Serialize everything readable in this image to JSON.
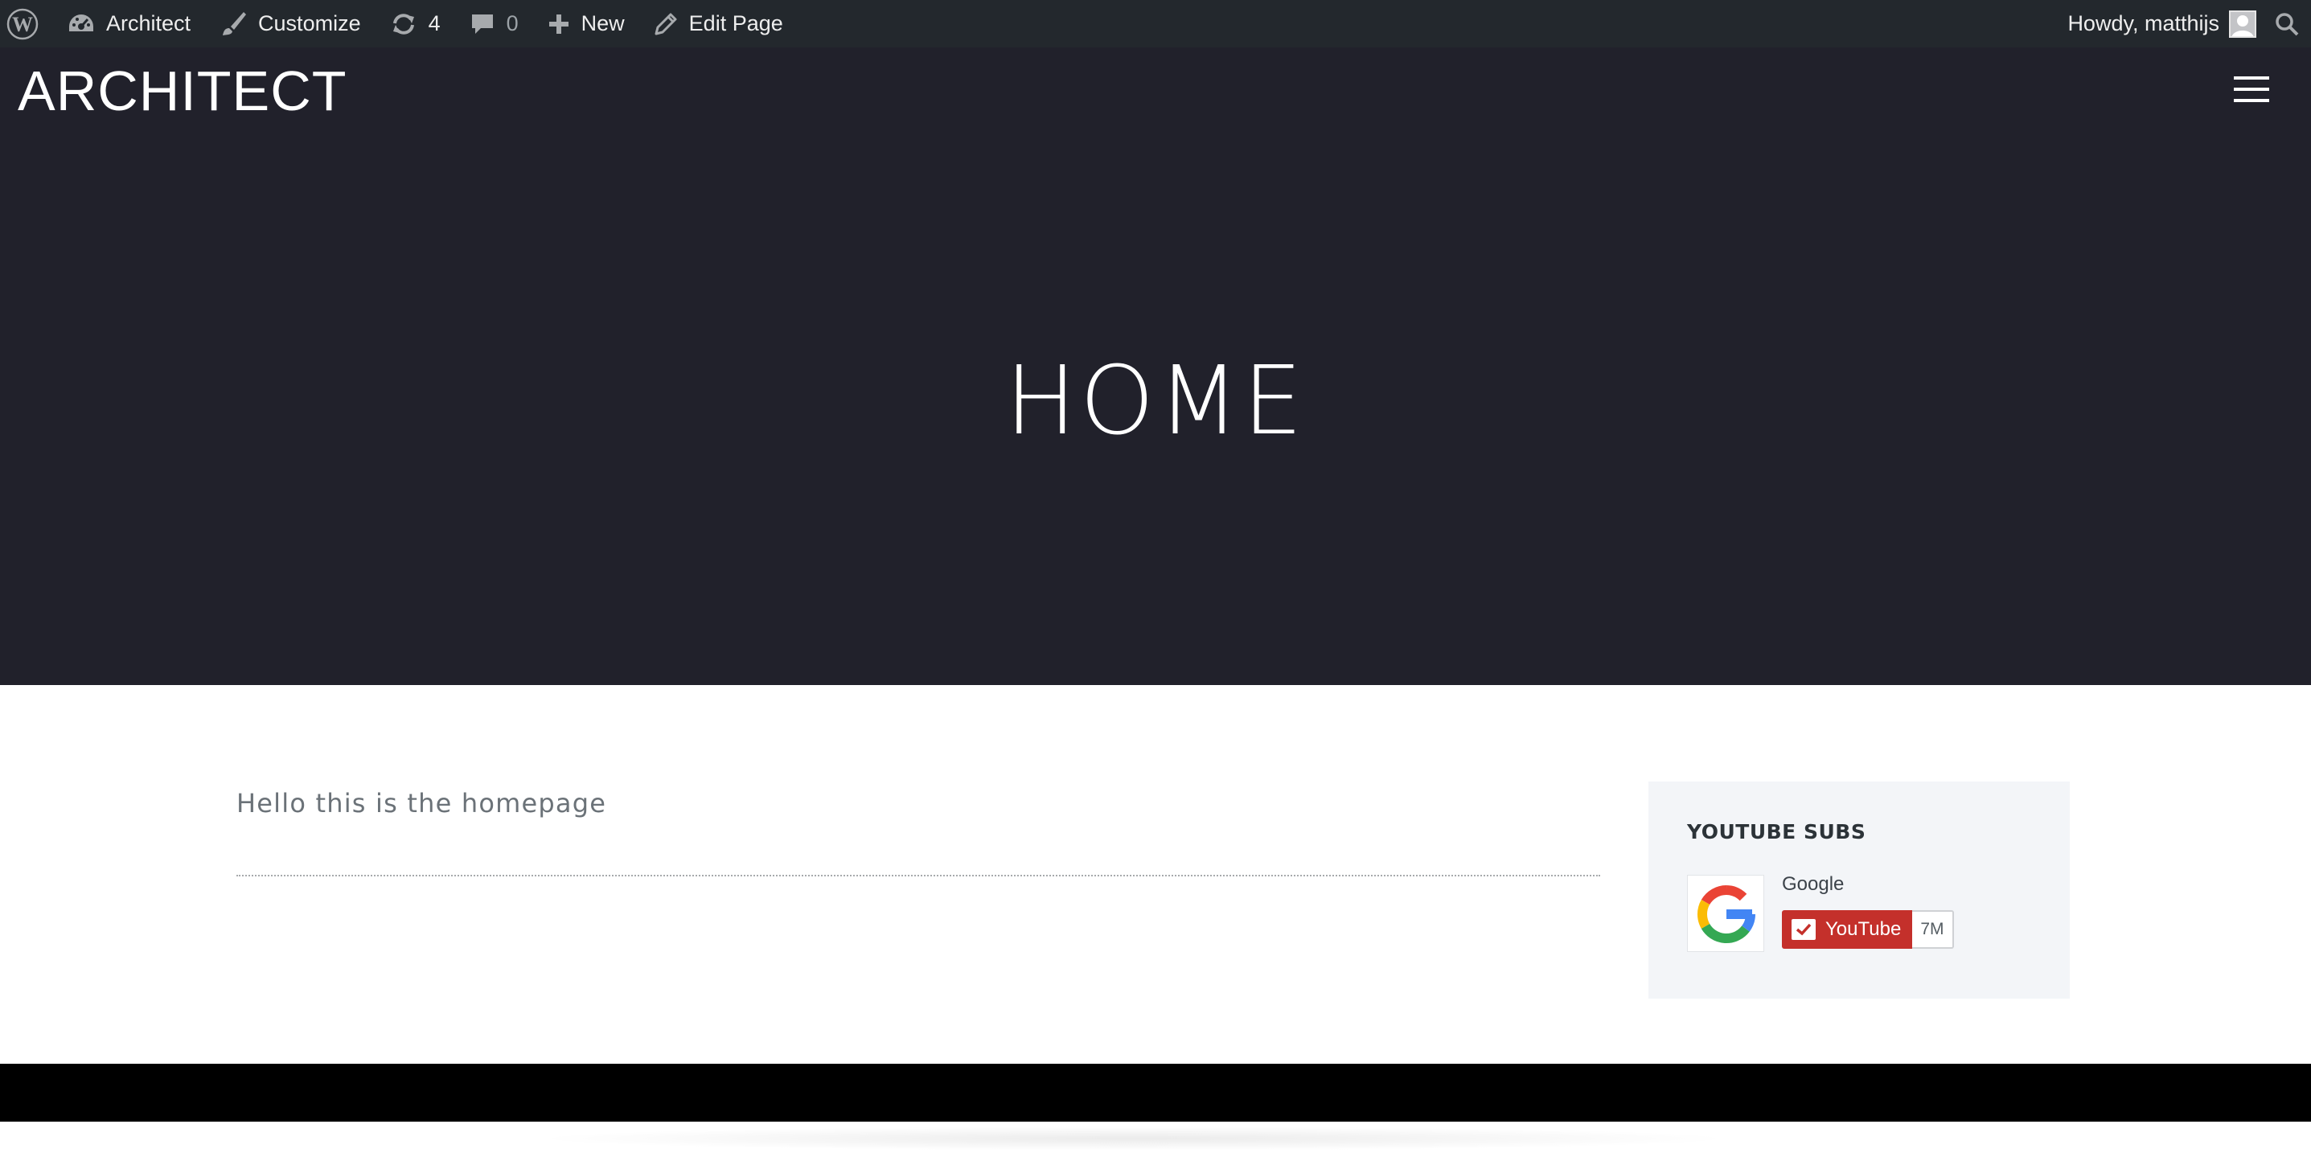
{
  "adminbar": {
    "site_name": "Architect",
    "customize_label": "Customize",
    "updates_count": "4",
    "comments_count": "0",
    "new_label": "New",
    "edit_page_label": "Edit Page",
    "greeting": "Howdy, matthijs"
  },
  "header": {
    "logo_text": "ARCHITECT"
  },
  "hero": {
    "title": "HOME"
  },
  "content": {
    "text": "Hello this is the homepage"
  },
  "widget": {
    "title": "YOUTUBE SUBS",
    "channel_name": "Google",
    "button_label": "YouTube",
    "subscriber_count": "7M"
  },
  "colors": {
    "adminbar_bg": "#23282d",
    "hero_bg": "#21212b",
    "youtube_red": "#c4302b",
    "widget_bg": "#f3f5f8",
    "footer_bg": "#000000"
  },
  "icons": {
    "wordpress": "wordpress-logo-icon",
    "site": "dashboard-icon",
    "customize": "paintbrush-icon",
    "updates": "refresh-icon",
    "comments": "comment-bubble-icon",
    "new": "plus-icon",
    "edit": "pencil-icon",
    "search": "search-icon",
    "menu": "hamburger-icon",
    "channel": "google-logo-icon",
    "subscribe": "checkmark-icon"
  }
}
